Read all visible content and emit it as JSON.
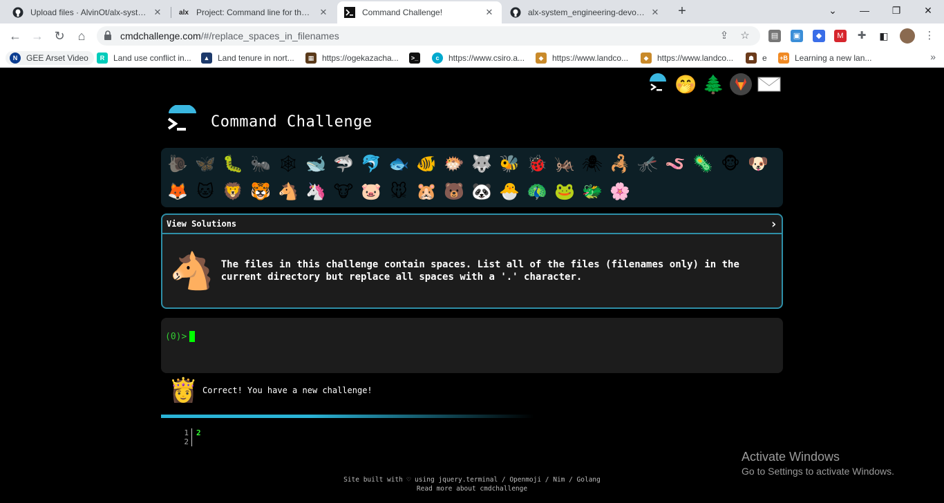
{
  "browser": {
    "tabs": [
      {
        "title": "Upload files · AlvinOt/alx-system_",
        "favicon": "github-icon"
      },
      {
        "title": "Project: Command line for the wi",
        "favicon": "alx-icon",
        "favicon_text": "alx"
      },
      {
        "title": "Command Challenge!",
        "favicon": "terminal-icon",
        "active": true
      },
      {
        "title": "alx-system_engineering-devops/",
        "favicon": "github-icon"
      }
    ],
    "url_host": "cmdchallenge.com",
    "url_path": "/#/replace_spaces_in_filenames",
    "bookmarks": [
      {
        "label": "GEE Arset Video",
        "icon": "nasa-icon"
      },
      {
        "label": "Land use conflict in...",
        "icon": "researchgate-icon"
      },
      {
        "label": "Land tenure in nort...",
        "icon": "site-icon"
      },
      {
        "label": "https://ogekazacha...",
        "icon": "site-icon"
      },
      {
        "label": "",
        "icon": "terminal-icon"
      },
      {
        "label": "https://www.csiro.a...",
        "icon": "csiro-icon"
      },
      {
        "label": "https://www.landco...",
        "icon": "fox-icon"
      },
      {
        "label": "https://www.landco...",
        "icon": "fox-icon"
      },
      {
        "label": "e",
        "icon": "crowd-icon"
      },
      {
        "label": "Learning a new lan...",
        "icon": "plus-b-icon",
        "icon_text": "+B"
      }
    ]
  },
  "page": {
    "title": "Command Challenge",
    "view_solutions": "View Solutions",
    "chevron": "›",
    "challenge_text": "The files in this challenge contain spaces. List all of the files (filenames only) in the current directory but replace all spaces with a '.' character.",
    "prompt": "(0)>",
    "result_message": "Correct! You have a new challenge!",
    "output_lines": [
      {
        "n": "1",
        "v": "2"
      },
      {
        "n": "2",
        "v": ""
      }
    ],
    "footer_line1": "Site built with ♡ using jquery.terminal / Openmoji / Nim / Golang",
    "footer_line2": "Read more about cmdchallenge",
    "top_icons": [
      "terminal-logo-icon",
      "hushed-face-icon",
      "tree-icon",
      "gitlab-icon",
      "envelope-icon"
    ],
    "emoji_row1": [
      "🐌",
      "🦋",
      "🐛",
      "🐜",
      "🕸",
      "🐋",
      "🦈",
      "🐬",
      "🐟",
      "🐠",
      "🐡",
      "🐺",
      "🐝",
      "🐞",
      "🦗",
      "🕷",
      "🦂",
      "🦟",
      "🪱",
      "🦠",
      "🐵",
      "🐶"
    ],
    "emoji_row2": [
      "🦊",
      "🐱",
      "🦁",
      "🐯",
      "🐴",
      "🦄",
      "🐮",
      "🐷",
      "🐭",
      "🐹",
      "🐻",
      "🐼",
      "🐣",
      "🦚",
      "🐸",
      "🐲",
      "🌸"
    ],
    "emoji_done_count": 2
  },
  "os_overlay": {
    "line1": "Activate Windows",
    "line2": "Go to Settings to activate Windows."
  },
  "colors": {
    "accent": "#2e8fa8",
    "prompt_green": "#33cc33",
    "cursor_green": "#00ff00",
    "progress": "#2ab3d6"
  }
}
